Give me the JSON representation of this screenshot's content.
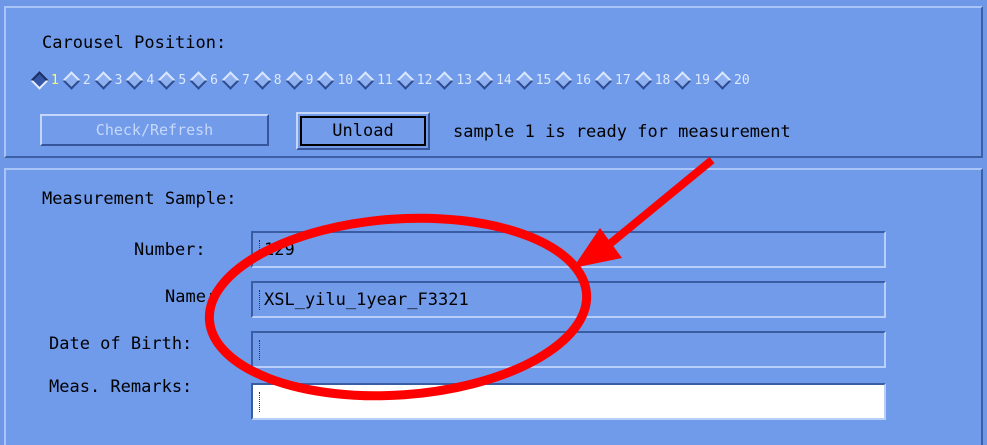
{
  "carousel": {
    "heading": "Carousel Position:",
    "positions": [
      "1",
      "2",
      "3",
      "4",
      "5",
      "6",
      "7",
      "8",
      "9",
      "10",
      "11",
      "12",
      "13",
      "14",
      "15",
      "16",
      "17",
      "18",
      "19",
      "20"
    ],
    "selected": "1",
    "check_refresh_label": "Check/Refresh",
    "unload_label": "Unload",
    "status": "sample 1 is ready for measurement"
  },
  "measurement": {
    "heading": "Measurement Sample:",
    "number_label": "Number:",
    "number_value": "129",
    "name_label": "Name:",
    "name_value": "XSL_yilu_1year_F3321",
    "dob_label": "Date of Birth:",
    "dob_value": "",
    "remarks_label": "Meas. Remarks:",
    "remarks_value": ""
  },
  "annotation": {
    "color": "#ff0000"
  }
}
